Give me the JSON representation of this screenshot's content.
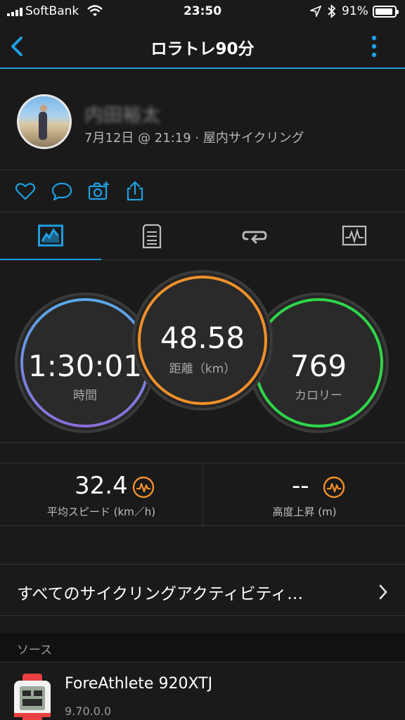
{
  "status_bar": {
    "carrier": "SoftBank",
    "time": "23:50",
    "battery_pct": "91%"
  },
  "nav": {
    "title": "ロラトレ90分"
  },
  "activity": {
    "user_name": "内田裕太",
    "meta": "7月12日 @ 21:19 · 屋内サイクリング"
  },
  "gauges": {
    "time": {
      "value": "1:30:01",
      "label": "時間"
    },
    "distance": {
      "value": "48.58",
      "label": "距離（km）"
    },
    "calories": {
      "value": "769",
      "label": "カロリー"
    }
  },
  "stats": {
    "avg_speed": {
      "value": "32.4",
      "label": "平均スピード (km／h)"
    },
    "elevation": {
      "value": "--",
      "label": "高度上昇 (m)"
    }
  },
  "all_activities_link": "すべてのサイクリングアクティビティ…",
  "source": {
    "header": "ソース",
    "device_name": "ForeAthlete 920XTJ",
    "version": "9.70.0.0"
  },
  "colors": {
    "accent": "#1f9fe0",
    "time_ring_start": "#5aa8e8",
    "time_ring_end": "#8a6ed8",
    "distance_ring": "#f0902a",
    "calories_ring": "#2ed64a",
    "zap_icon": "#f0902a"
  }
}
